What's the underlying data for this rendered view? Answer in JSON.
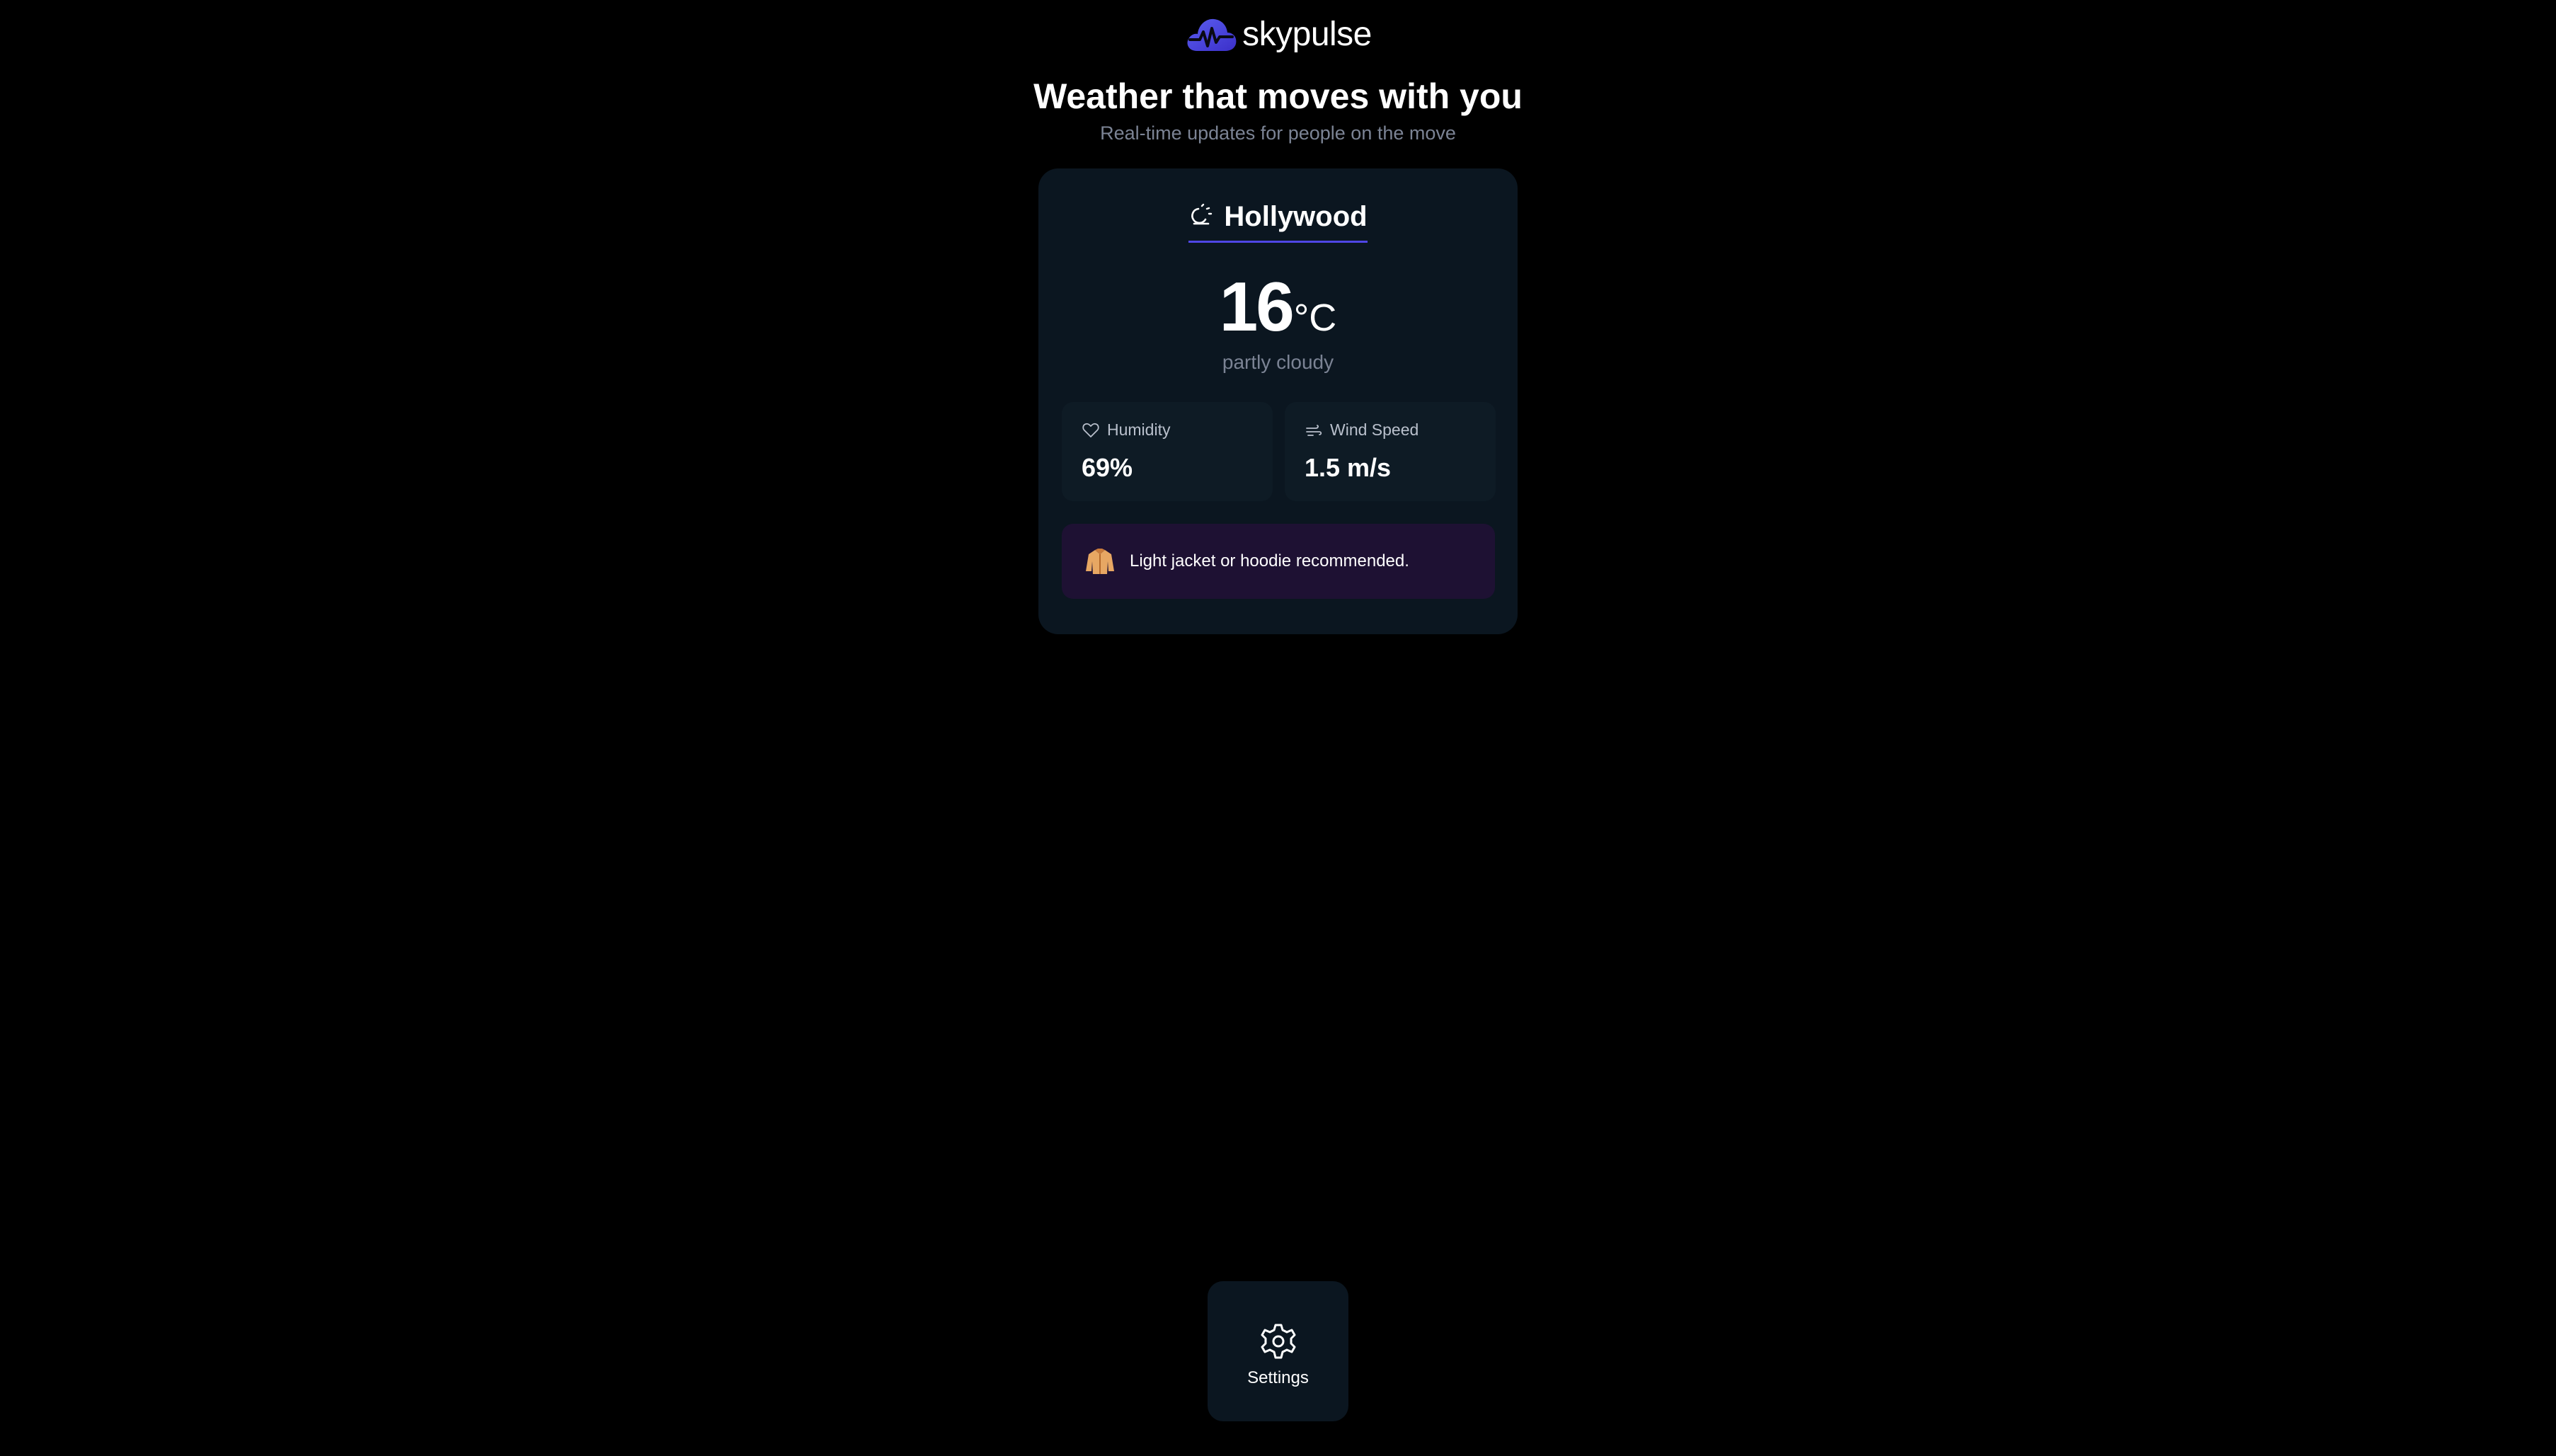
{
  "brand": {
    "name": "skypulse",
    "logo_icon": "cloud-pulse-icon",
    "accent_color": "#4f46e5"
  },
  "hero": {
    "title": "Weather that moves with you",
    "subtitle": "Real-time updates for people on the move"
  },
  "weather_card": {
    "city": "Hollywood",
    "condition_icon": "partly-cloudy-icon",
    "temperature": "16",
    "unit": "°C",
    "condition": "partly cloudy",
    "stats": [
      {
        "label": "Humidity",
        "value": "69%",
        "icon": "heart-icon"
      },
      {
        "label": "Wind Speed",
        "value": "1.5 m/s",
        "icon": "wind-icon"
      }
    ],
    "advice": {
      "icon": "jacket-icon",
      "text": "Light jacket or hoodie recommended."
    }
  },
  "nav": {
    "settings_label": "Settings",
    "settings_icon": "gear-icon"
  }
}
